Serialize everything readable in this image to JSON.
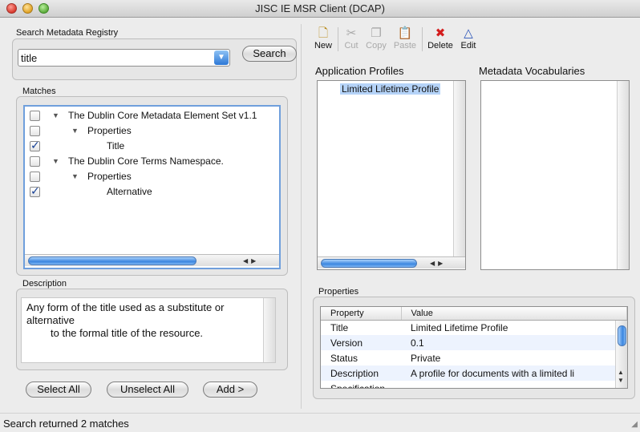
{
  "window": {
    "title": "JISC IE MSR Client (DCAP)"
  },
  "search": {
    "section_label": "Search Metadata Registry",
    "query": "title",
    "button_label": "Search"
  },
  "matches": {
    "section_label": "Matches",
    "rows": [
      {
        "label": "The Dublin Core Metadata Element Set v1.1",
        "checked": false,
        "level": 0,
        "disclosure": true
      },
      {
        "label": "Properties",
        "checked": false,
        "level": 1,
        "disclosure": true
      },
      {
        "label": "Title",
        "checked": true,
        "level": 2,
        "disclosure": false
      },
      {
        "label": "The Dublin Core Terms Namespace.",
        "checked": false,
        "level": 0,
        "disclosure": true
      },
      {
        "label": "Properties",
        "checked": false,
        "level": 1,
        "disclosure": true
      },
      {
        "label": "Alternative",
        "checked": true,
        "level": 2,
        "disclosure": false
      }
    ]
  },
  "description": {
    "section_label": "Description",
    "line1": "Any form of the title used as a substitute or",
    "line2": "alternative",
    "line3": "to the formal title of the resource."
  },
  "buttons": {
    "select_all": "Select All",
    "unselect_all": "Unselect All",
    "add": "Add >"
  },
  "toolbar": {
    "new": "New",
    "cut": "Cut",
    "copy": "Copy",
    "paste": "Paste",
    "delete": "Delete",
    "edit": "Edit"
  },
  "application_profiles": {
    "header": "Application Profiles",
    "items": [
      "Limited Lifetime Profile"
    ]
  },
  "metadata_vocabularies": {
    "header": "Metadata Vocabularies"
  },
  "properties": {
    "section_label": "Properties",
    "columns": [
      "Property",
      "Value"
    ],
    "rows": [
      {
        "property": "Title",
        "value": "Limited Lifetime Profile"
      },
      {
        "property": "Version",
        "value": "0.1"
      },
      {
        "property": "Status",
        "value": "Private"
      },
      {
        "property": "Description",
        "value": "A profile for documents with a limited li"
      },
      {
        "property": "Specification",
        "value": ""
      }
    ]
  },
  "status_bar": {
    "text": "Search returned 2 matches"
  },
  "colors": {
    "selection": "#b5d3f8",
    "accent": "#3b86e0"
  }
}
